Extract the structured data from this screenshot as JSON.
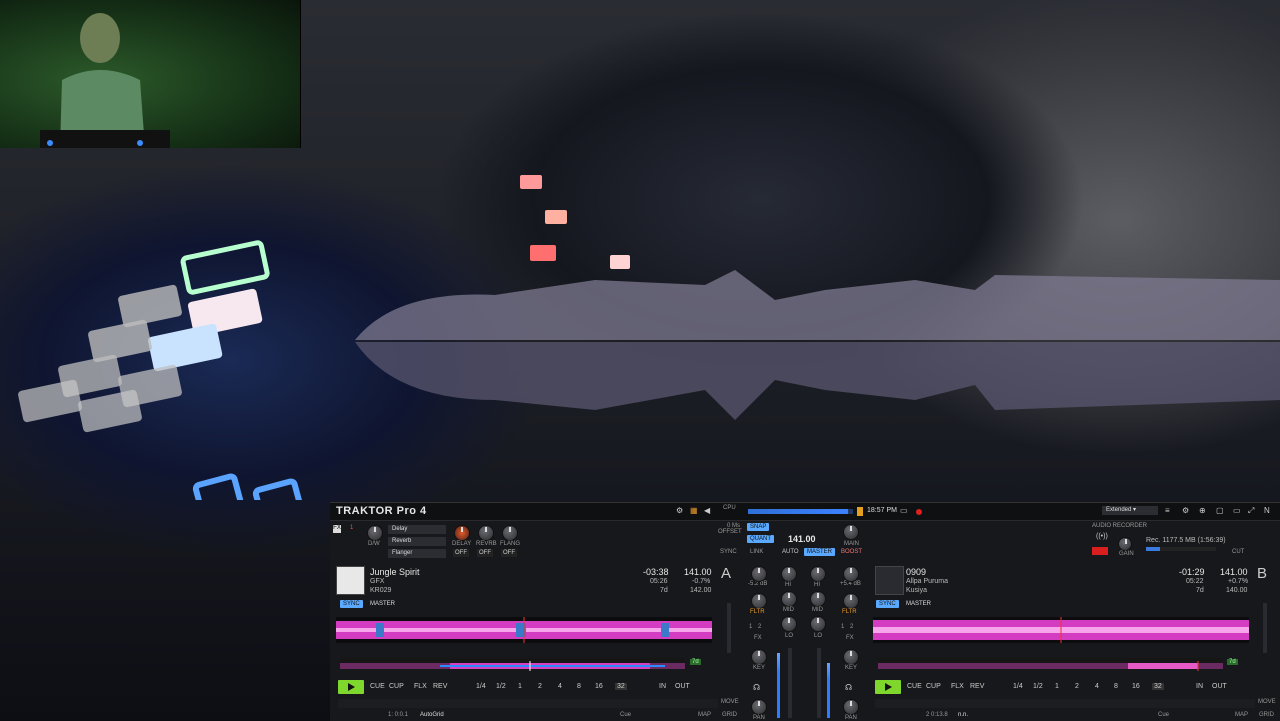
{
  "app": {
    "title": "TRAKTOR Pro 4"
  },
  "header": {
    "time": "18:57 PM",
    "layout_select": "Extended",
    "audio_recorder": "AUDIO RECORDER",
    "rec_info": "Rec. 1177.5 MB (1:56:39)",
    "gain": "GAIN",
    "cut": "CUT",
    "cpu": "CPU"
  },
  "fx": {
    "unit_label": "FX",
    "unit_num": "1",
    "dw": "D/W",
    "effects": [
      "Delay",
      "Reverb",
      "Flanger"
    ],
    "knob_labels": [
      "DELAY",
      "REVRB",
      "FLANG"
    ],
    "offs": [
      "OFF",
      "OFF",
      "OFF"
    ]
  },
  "master": {
    "offset_label": "0 Ms\nOFFSET",
    "sync_label": "SYNC",
    "snap": "SNAP",
    "quant": "QUANT",
    "link": "LINK",
    "bpm": "141.00",
    "auto": "AUTO",
    "master": "MASTER",
    "main": "MAIN",
    "boost": "BOOST"
  },
  "deck_a": {
    "letter": "A",
    "title": "Jungle Spirit",
    "artist": "GFX",
    "label": "KR029",
    "remaining": "-03:38",
    "elapsed": "05:26",
    "key": "7d",
    "bpm": "141.00",
    "pitch": "-0.7%",
    "orig_bpm": "142.00",
    "sync": "SYNC",
    "master": "MASTER",
    "cue": "CUE",
    "cup": "CUP",
    "flx": "FLX",
    "rev": "REV",
    "loops": [
      "1/4",
      "1/2",
      "1",
      "2",
      "4",
      "8",
      "16",
      "32"
    ],
    "in": "IN",
    "out": "OUT",
    "keylock": "7d",
    "pos_info": "1: 0:0.1",
    "autogrid": "AutoGrid",
    "cue_sel": "Cue",
    "map": "MAP",
    "move": "MOVE",
    "grid": "GRID"
  },
  "deck_b": {
    "letter": "B",
    "title": "0909",
    "artist": "Allpa Puruma",
    "label": "Kusiya",
    "remaining": "-01:29",
    "elapsed": "05:22",
    "key": "7d",
    "bpm": "141.00",
    "pitch": "+0.7%",
    "orig_bpm": "140.00",
    "sync": "SYNC",
    "master": "MASTER",
    "cue": "CUE",
    "cup": "CUP",
    "flx": "FLX",
    "rev": "REV",
    "loops": [
      "1/4",
      "1/2",
      "1",
      "2",
      "4",
      "8",
      "16",
      "32"
    ],
    "in": "IN",
    "out": "OUT",
    "keylock": "7d",
    "pos_info": "2 0:13.8",
    "autogrid": "n.n.",
    "cue_sel": "Cue",
    "map": "MAP",
    "move": "MOVE",
    "grid": "GRID"
  },
  "mixer": {
    "gain_a": "-5.2 dB",
    "gain_b": "+5.4 dB",
    "hi": "HI",
    "mid": "MID",
    "lo": "LO",
    "fltr": "FLTR",
    "fx": "FX",
    "key": "KEY",
    "pan": "PAN",
    "one": "1",
    "two": "2"
  },
  "colors": {
    "accent": "#5aa9ff",
    "waveform": "#e040c8",
    "play": "#7fd62c",
    "rec": "#e02020"
  }
}
